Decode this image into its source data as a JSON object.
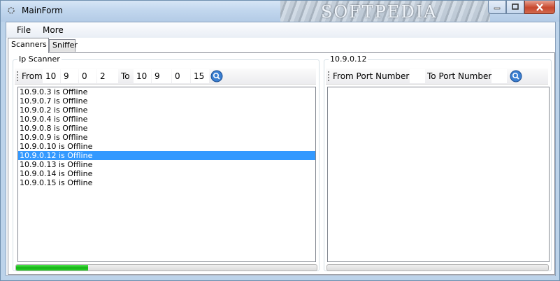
{
  "window": {
    "title": "MainForm",
    "watermark": "SOFTPEDIA"
  },
  "menu": [
    "File",
    "More"
  ],
  "tabs": [
    {
      "label": "Scanners",
      "active": true
    },
    {
      "label": "Sniffer",
      "active": false
    }
  ],
  "ip_scanner": {
    "title": "Ip Scanner",
    "from_label": "From",
    "from_ip": [
      "10",
      "9",
      "0",
      "2"
    ],
    "to_label": "To",
    "to_ip": [
      "10",
      "9",
      "0",
      "15"
    ],
    "results": [
      "10.9.0.3 is Offline",
      "10.9.0.7 is Offline",
      "10.9.0.2 is Offline",
      "10.9.0.4 is Offline",
      "10.9.0.8 is Offline",
      "10.9.0.9 is Offline",
      "10.9.0.10 is Offline",
      "10.9.0.12 is Offline",
      "10.9.0.13 is Offline",
      "10.9.0.14 is Offline",
      "10.9.0.15 is Offline"
    ],
    "selected_index": 7,
    "progress_percent": 24
  },
  "port_scanner": {
    "title": "10.9.0.12",
    "from_port_label": "From Port Number",
    "to_port_label": "To Port Number",
    "progress_percent": 0
  },
  "colors": {
    "selection": "#3399ff",
    "progress": "#16b316"
  }
}
